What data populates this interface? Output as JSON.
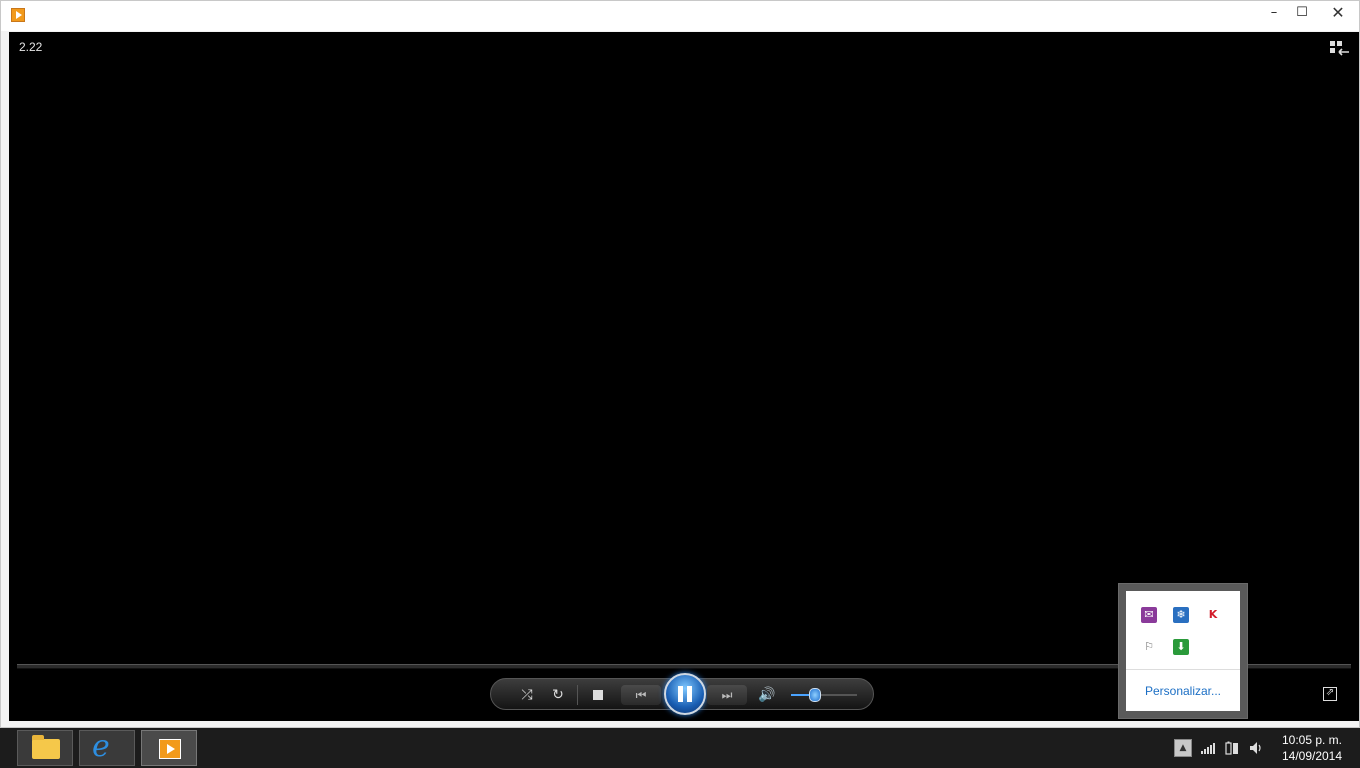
{
  "window": {
    "title": "",
    "app_icon": "windows-media-player-icon",
    "minimize": "–",
    "maximize": "☐",
    "close": "✕"
  },
  "player": {
    "timecode": "2.22",
    "library_icon": "switch-to-library-icon",
    "controls": {
      "shuffle": "⤮",
      "repeat": "↻",
      "previous": "⏮",
      "next": "⏭",
      "volume": "🔊",
      "state": "playing"
    },
    "volume_level": 0.35,
    "fullscreen_icon": "⇗"
  },
  "tray_overflow": {
    "icons": [
      "chat-icon",
      "snowflake-icon",
      "kaspersky-icon",
      "action-center-flag-icon",
      "download-icon"
    ],
    "customize_label": "Personalizar..."
  },
  "taskbar": {
    "apps": [
      "file-explorer",
      "internet-explorer",
      "windows-media-player"
    ],
    "ie_glyph": "e",
    "show_hidden": "▲",
    "clock_time": "10:05 p. m.",
    "clock_date": "14/09/2014"
  },
  "colors": {
    "accent": "#1a5fb4",
    "taskbar": "#1c1c1c",
    "link": "#1c6fc5"
  }
}
